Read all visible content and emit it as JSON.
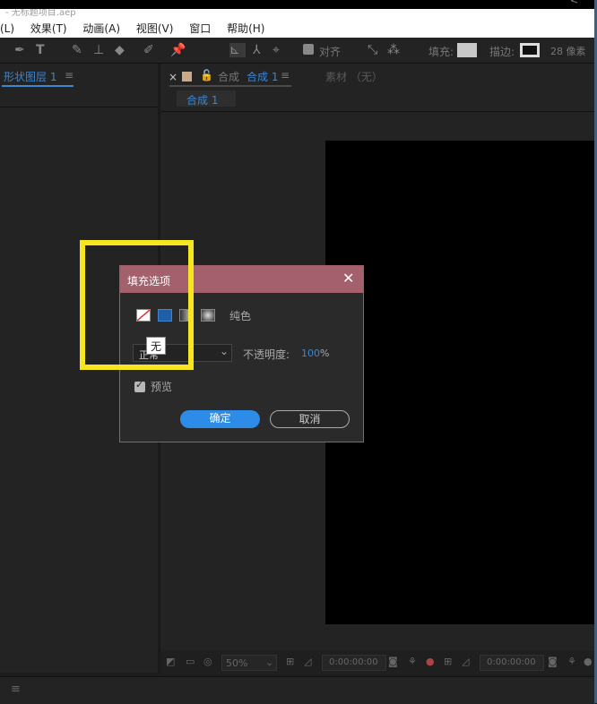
{
  "titlebar": {
    "right_text": "<"
  },
  "window": {
    "filepath": "- 无标题项目.aep"
  },
  "menubar": {
    "items": [
      "(L)",
      "效果(T)",
      "动画(A)",
      "视图(V)",
      "窗口",
      "帮助(H)"
    ]
  },
  "toolbar": {
    "align_label": "对齐",
    "fill_label": "填充:",
    "stroke_label": "描边:",
    "stroke_width": "28 像素"
  },
  "left_panel": {
    "tab_label": "形状图层 1",
    "menu_glyph": "≡"
  },
  "comp_panel": {
    "close_glyph": "×",
    "comp_tab_prefix": "合成",
    "comp_tab_name": "合成 1",
    "menu_glyph": "≡",
    "footage_label": "素材 （无）",
    "breadcrumb": "合成 1"
  },
  "viewer_bar": {
    "zoom": "50%",
    "timecode_1": "0:00:00:00",
    "timecode_2": "0:00:00:00"
  },
  "status": {
    "menu_glyph": "≡"
  },
  "dialog": {
    "title": "填充选项",
    "fill_type_label": "纯色",
    "tooltip": "无",
    "blend_mode": "正常",
    "opacity_label": "不透明度:",
    "opacity_value": "100",
    "opacity_unit": "%",
    "preview_label": "预览",
    "preview_checked": true,
    "ok_label": "确定",
    "cancel_label": "取消"
  },
  "colors": {
    "accent": "#3d86d0",
    "dialog_header": "#a4606c",
    "highlight": "#f6e61f",
    "ok_button": "#2d8ce8"
  }
}
